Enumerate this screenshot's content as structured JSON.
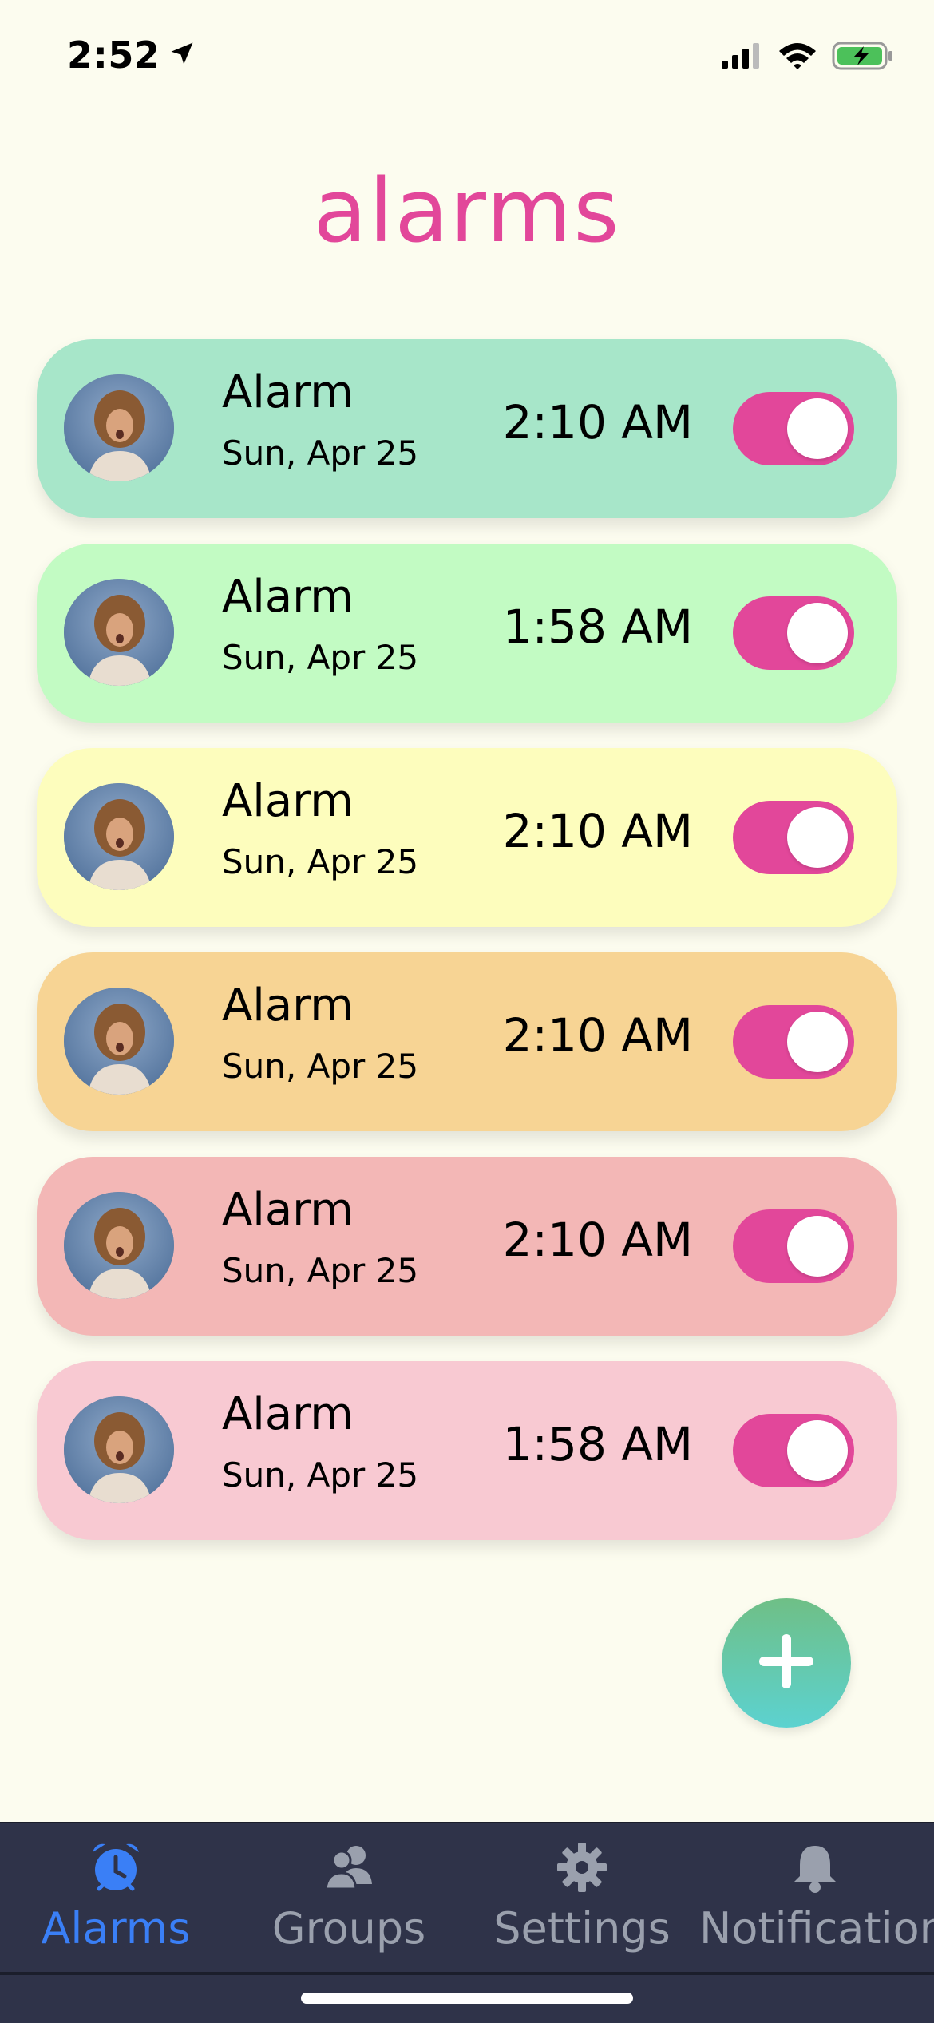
{
  "status_bar": {
    "time": "2:52"
  },
  "page": {
    "title": "alarms"
  },
  "alarms": [
    {
      "name": "Alarm",
      "date": "Sun, Apr 25",
      "time": "2:10 AM",
      "color": "#a7e6c9",
      "enabled": true
    },
    {
      "name": "Alarm",
      "date": "Sun, Apr 25",
      "time": "1:58 AM",
      "color": "#c2fbc3",
      "enabled": true
    },
    {
      "name": "Alarm",
      "date": "Sun, Apr 25",
      "time": "2:10 AM",
      "color": "#fdfdbd",
      "enabled": true
    },
    {
      "name": "Alarm",
      "date": "Sun, Apr 25",
      "time": "2:10 AM",
      "color": "#f7d494",
      "enabled": true
    },
    {
      "name": "Alarm",
      "date": "Sun, Apr 25",
      "time": "2:10 AM",
      "color": "#f3b7b6",
      "enabled": true
    },
    {
      "name": "Alarm",
      "date": "Sun, Apr 25",
      "time": "1:58 AM",
      "color": "#f8c9d2",
      "enabled": true
    }
  ],
  "tabs": [
    {
      "label": "Alarms",
      "icon": "alarm-clock-icon",
      "active": true
    },
    {
      "label": "Groups",
      "icon": "people-icon",
      "active": false
    },
    {
      "label": "Settings",
      "icon": "gear-icon",
      "active": false
    },
    {
      "label": "Notifications",
      "icon": "bell-icon",
      "active": false
    }
  ],
  "colors": {
    "accent": "#e2479a",
    "tab_active": "#3a7ff6",
    "tab_inactive": "#9aa0ad",
    "tab_bar_bg": "#2f3349",
    "background": "#fcfcef"
  }
}
